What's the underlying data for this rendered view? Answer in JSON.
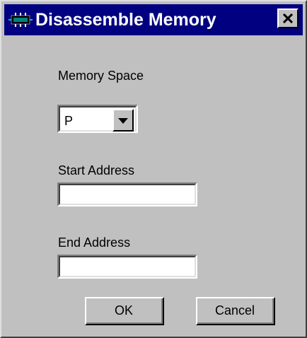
{
  "window": {
    "title": "Disassemble Memory",
    "icon": "memory-chip-icon",
    "close_icon": "close-icon"
  },
  "memory_space": {
    "label": "Memory Space",
    "selected": "P",
    "dropdown_icon": "chevron-down-icon"
  },
  "start_address": {
    "label": "Start Address",
    "value": ""
  },
  "end_address": {
    "label": "End Address",
    "value": ""
  },
  "buttons": {
    "ok_label": "OK",
    "cancel_label": "Cancel"
  },
  "colors": {
    "titlebar": "#000080",
    "face": "#c0c0c0"
  }
}
